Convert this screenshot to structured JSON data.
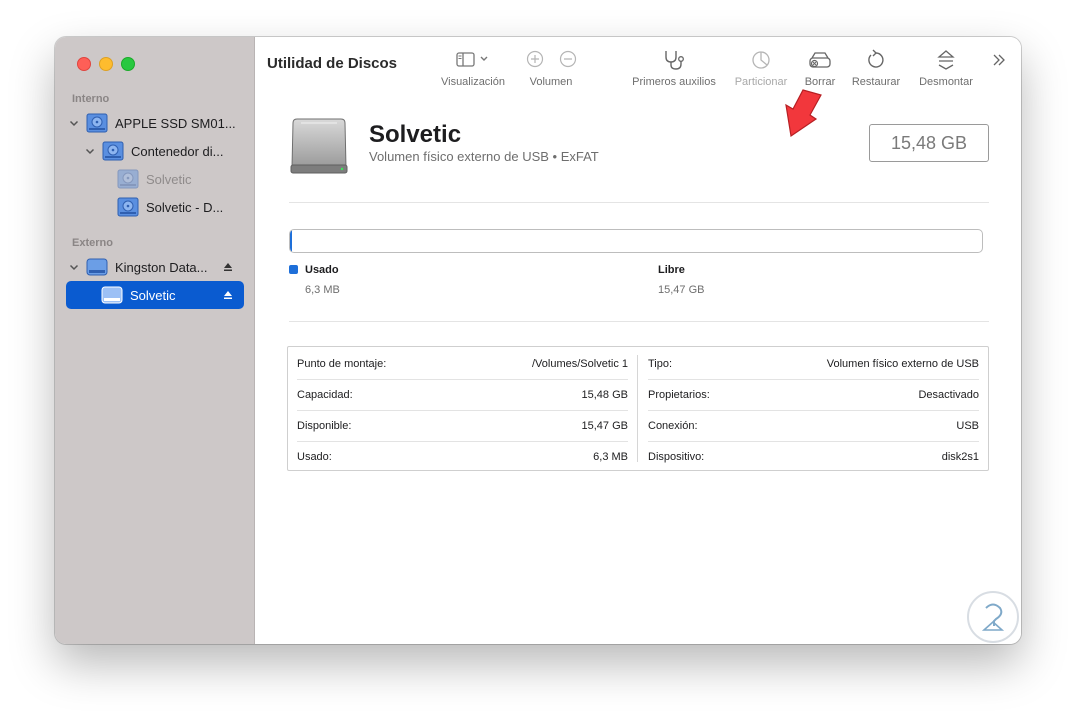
{
  "window": {
    "title": "Utilidad de Discos"
  },
  "sidebar": {
    "internal_label": "Interno",
    "external_label": "Externo",
    "internal_items": [
      {
        "label": "APPLE SSD SM01...",
        "level": 0
      },
      {
        "label": "Contenedor di...",
        "level": 1
      },
      {
        "label": "Solvetic",
        "level": 2,
        "dimmed": true
      },
      {
        "label": "Solvetic - D...",
        "level": 2
      }
    ],
    "external_items": [
      {
        "label": "Kingston Data...",
        "level": 0
      },
      {
        "label": "Solvetic",
        "level": 1,
        "selected": true
      }
    ]
  },
  "toolbar": {
    "visualizacion": "Visualización",
    "volumen": "Volumen",
    "primeros_auxilios": "Primeros auxilios",
    "particionar": "Particionar",
    "borrar": "Borrar",
    "restaurar": "Restaurar",
    "desmontar": "Desmontar"
  },
  "volume": {
    "name": "Solvetic",
    "subtitle": "Volumen físico externo de USB • ExFAT",
    "capacity_display": "15,48 GB"
  },
  "usage": {
    "used_label": "Usado",
    "used_value": "6,3 MB",
    "free_label": "Libre",
    "free_value": "15,47 GB",
    "used_fraction": 0.0004,
    "used_color": "#1e6fd9"
  },
  "details": {
    "left": [
      {
        "key": "Punto de montaje:",
        "value": "/Volumes/Solvetic 1"
      },
      {
        "key": "Capacidad:",
        "value": "15,48 GB"
      },
      {
        "key": "Disponible:",
        "value": "15,47 GB"
      },
      {
        "key": "Usado:",
        "value": "6,3 MB"
      }
    ],
    "right": [
      {
        "key": "Tipo:",
        "value": "Volumen físico externo de USB"
      },
      {
        "key": "Propietarios:",
        "value": "Desactivado"
      },
      {
        "key": "Conexión:",
        "value": "USB"
      },
      {
        "key": "Dispositivo:",
        "value": "disk2s1"
      }
    ]
  },
  "colors": {
    "accent": "#0a5bd0",
    "sidebar_bg": "#cdc8c8",
    "annotation_arrow": "#f2373c"
  },
  "icons": {
    "sidebar_toggle": "sidebar-icon",
    "add_volume": "plus-circle-icon",
    "remove_volume": "minus-circle-icon",
    "first_aid": "stethoscope-icon",
    "partition": "pie-chart-icon",
    "erase": "erase-disk-icon",
    "restore": "restore-icon",
    "unmount": "eject-icon",
    "overflow": "chevron-double-right-icon"
  }
}
